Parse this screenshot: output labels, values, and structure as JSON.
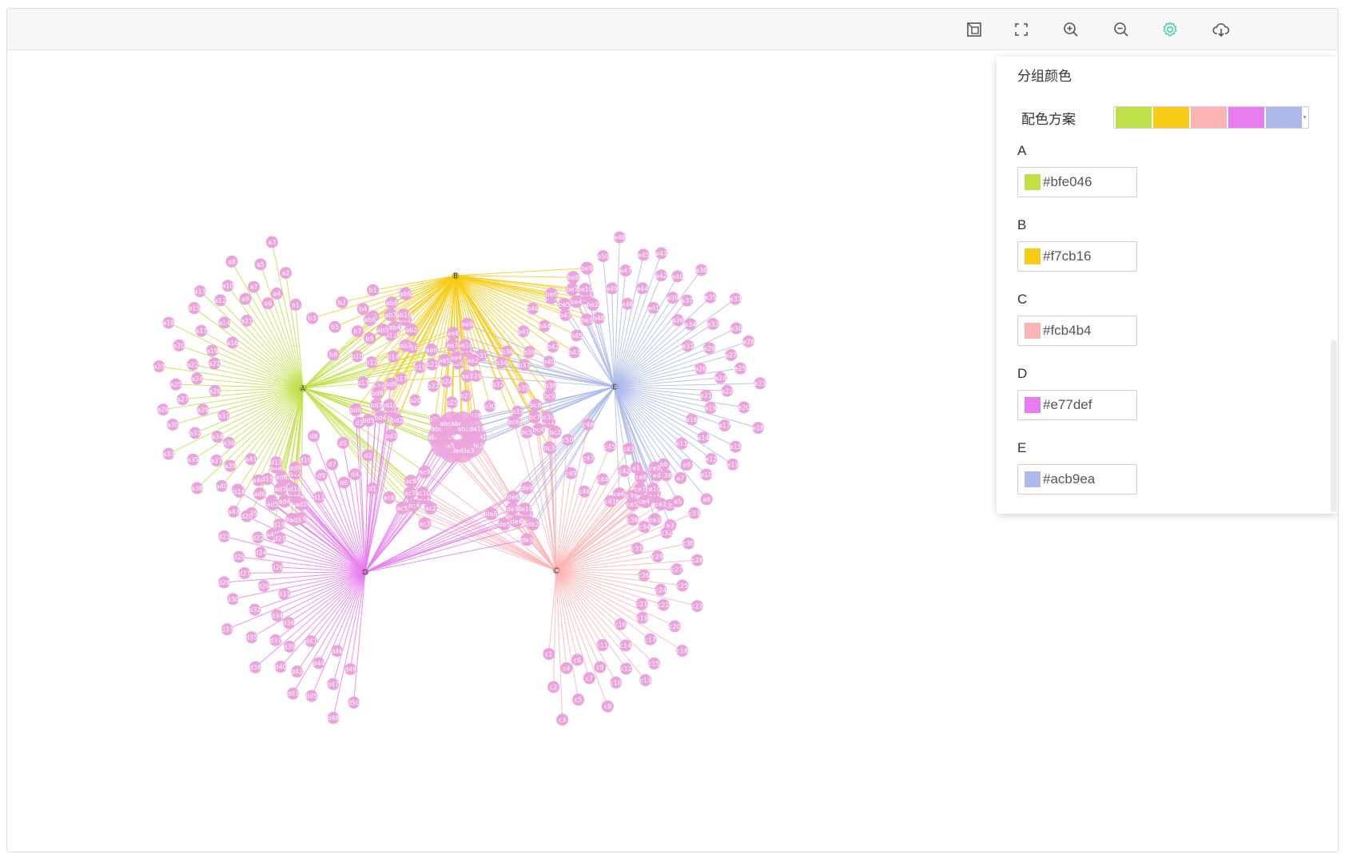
{
  "toolbar": {
    "buttons": [
      {
        "name": "fit-view-button",
        "icon": "fit-view-icon"
      },
      {
        "name": "fullscreen-button",
        "icon": "fullscreen-icon"
      },
      {
        "name": "zoom-in-button",
        "icon": "zoom-in-icon"
      },
      {
        "name": "zoom-out-button",
        "icon": "zoom-out-icon"
      },
      {
        "name": "settings-button",
        "icon": "gear-icon",
        "active": true
      },
      {
        "name": "download-button",
        "icon": "cloud-download-icon"
      }
    ]
  },
  "graph": {
    "hubs": [
      {
        "id": "A",
        "color": "#bfe046",
        "count": 50
      },
      {
        "id": "B",
        "color": "#f7cb16",
        "count": 50
      },
      {
        "id": "C",
        "color": "#fcb4b4",
        "count": 50
      },
      {
        "id": "D",
        "color": "#e77def",
        "count": 50
      },
      {
        "id": "E",
        "color": "#acb9ea",
        "count": 50
      }
    ],
    "pairs": [
      {
        "prefix": "ab",
        "groups": [
          "A",
          "B"
        ],
        "count": 10
      },
      {
        "prefix": "ac",
        "groups": [
          "A",
          "C"
        ],
        "count": 10
      },
      {
        "prefix": "ad",
        "groups": [
          "A",
          "D"
        ],
        "count": 10
      },
      {
        "prefix": "ae",
        "groups": [
          "A",
          "E"
        ],
        "count": 10
      },
      {
        "prefix": "bc",
        "groups": [
          "B",
          "C"
        ],
        "count": 10
      },
      {
        "prefix": "bd",
        "groups": [
          "B",
          "D"
        ],
        "count": 10
      },
      {
        "prefix": "be",
        "groups": [
          "B",
          "E"
        ],
        "count": 10
      },
      {
        "prefix": "ce",
        "groups": [
          "C",
          "E"
        ],
        "count": 10
      },
      {
        "prefix": "de",
        "groups": [
          "D",
          "E"
        ],
        "count": 10
      }
    ],
    "center_cluster": {
      "prefix": "abcde",
      "groups": [
        "A",
        "B",
        "C",
        "D",
        "E"
      ],
      "count": 10
    },
    "node_color": "#eca3dc"
  },
  "settings_panel": {
    "title": "分组颜色",
    "scheme_label": "配色方案",
    "scheme_colors": [
      "#bfe046",
      "#f7cb16",
      "#fcb4b4",
      "#e77def",
      "#acb9ea"
    ],
    "groups": [
      {
        "name": "A",
        "color": "#bfe046"
      },
      {
        "name": "B",
        "color": "#f7cb16"
      },
      {
        "name": "C",
        "color": "#fcb4b4"
      },
      {
        "name": "D",
        "color": "#e77def"
      },
      {
        "name": "E",
        "color": "#acb9ea"
      }
    ]
  }
}
